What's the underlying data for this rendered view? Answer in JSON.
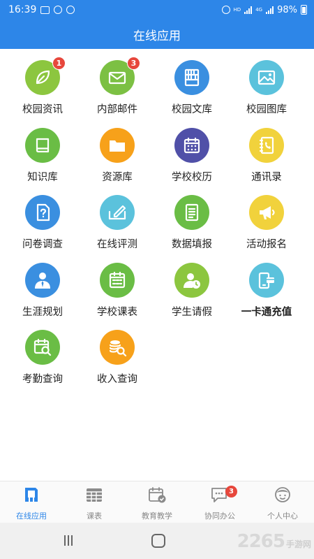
{
  "status_bar": {
    "time": "16:39",
    "network": "HD",
    "network2": "4G",
    "battery": "98%"
  },
  "header": {
    "title": "在线应用"
  },
  "apps": [
    {
      "label": "校园资讯",
      "icon": "leaf-icon",
      "color": "#8cc63f",
      "badge": "1"
    },
    {
      "label": "内部邮件",
      "icon": "mail-icon",
      "color": "#7cc043",
      "badge": "3"
    },
    {
      "label": "校园文库",
      "icon": "bookshelf-icon",
      "color": "#3a8fe0",
      "badge": ""
    },
    {
      "label": "校园图库",
      "icon": "image-icon",
      "color": "#5bc2dc",
      "badge": ""
    },
    {
      "label": "知识库",
      "icon": "book-icon",
      "color": "#6abd45",
      "badge": ""
    },
    {
      "label": "资源库",
      "icon": "folder-icon",
      "color": "#f7a11a",
      "badge": ""
    },
    {
      "label": "学校校历",
      "icon": "calendar-icon",
      "color": "#5050a8",
      "badge": ""
    },
    {
      "label": "通讯录",
      "icon": "phone-book-icon",
      "color": "#f1d23c",
      "badge": ""
    },
    {
      "label": "问卷调查",
      "icon": "question-doc-icon",
      "color": "#3a8fe0",
      "badge": ""
    },
    {
      "label": "在线评测",
      "icon": "edit-box-icon",
      "color": "#5bc2dc",
      "badge": ""
    },
    {
      "label": "数据填报",
      "icon": "form-icon",
      "color": "#6abd45",
      "badge": ""
    },
    {
      "label": "活动报名",
      "icon": "megaphone-icon",
      "color": "#f1d23c",
      "badge": ""
    },
    {
      "label": "生涯规划",
      "icon": "person-tie-icon",
      "color": "#3a8fe0",
      "badge": ""
    },
    {
      "label": "学校课表",
      "icon": "timetable-icon",
      "color": "#6abd45",
      "badge": ""
    },
    {
      "label": "学生请假",
      "icon": "person-clock-icon",
      "color": "#8cc63f",
      "badge": ""
    },
    {
      "label": "一卡通充值",
      "icon": "card-phone-icon",
      "color": "#5bc2dc",
      "badge": "",
      "bold": true
    },
    {
      "label": "考勤查询",
      "icon": "calendar-search-icon",
      "color": "#6abd45",
      "badge": ""
    },
    {
      "label": "收入查询",
      "icon": "coin-search-icon",
      "color": "#f7a11a",
      "badge": ""
    }
  ],
  "tabs": [
    {
      "label": "在线应用",
      "icon": "apps-icon",
      "active": true,
      "badge": ""
    },
    {
      "label": "课表",
      "icon": "timetable-tab-icon",
      "active": false,
      "badge": ""
    },
    {
      "label": "教育教学",
      "icon": "calendar-check-icon",
      "active": false,
      "badge": ""
    },
    {
      "label": "协同办公",
      "icon": "chat-icon",
      "active": false,
      "badge": "3"
    },
    {
      "label": "个人中心",
      "icon": "user-avatar-icon",
      "active": false,
      "badge": ""
    }
  ],
  "watermark": {
    "number": "2265",
    "suffix": "手游网"
  },
  "colors": {
    "accent": "#2d86e8",
    "badge": "#e7473c"
  }
}
